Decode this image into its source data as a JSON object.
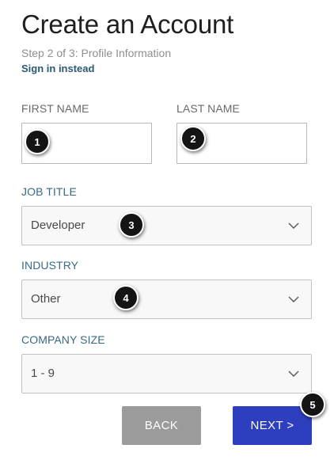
{
  "header": {
    "title": "Create an Account",
    "step": "Step 2 of 3: Profile Information",
    "signin_link": "Sign in instead"
  },
  "form": {
    "first_name": {
      "label": "FIRST NAME",
      "value": ""
    },
    "last_name": {
      "label": "LAST NAME",
      "value": ""
    },
    "job_title": {
      "label": "JOB TITLE",
      "selected": "Developer"
    },
    "industry": {
      "label": "INDUSTRY",
      "selected": "Other"
    },
    "company_size": {
      "label": "COMPANY SIZE",
      "selected": "1 - 9"
    }
  },
  "buttons": {
    "back": "BACK",
    "next": "NEXT >"
  },
  "annotations": [
    "1",
    "2",
    "3",
    "4",
    "5"
  ],
  "colors": {
    "next_button": "#2d3fbf",
    "back_button": "#9b9b9b",
    "field_label_blue": "#3a6a86",
    "link": "#2c5a73"
  }
}
